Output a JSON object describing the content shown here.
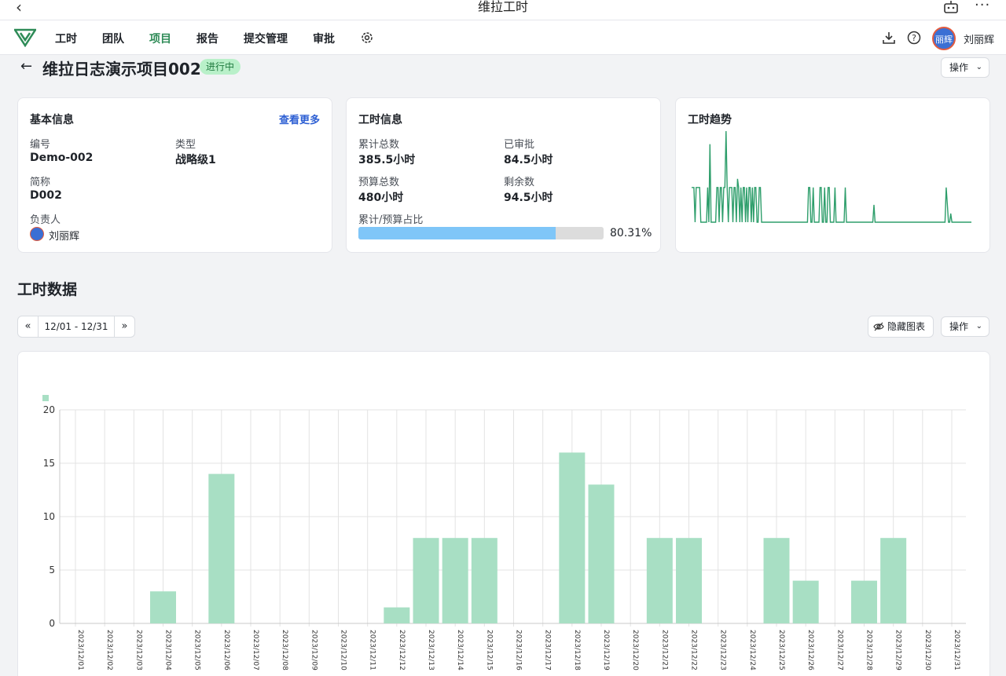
{
  "titlebar": {
    "back": "‹",
    "title": "维拉工时",
    "more": "···"
  },
  "nav": {
    "items": [
      "工时",
      "团队",
      "项目",
      "报告",
      "提交管理",
      "审批"
    ],
    "active": "项目",
    "avatar_text": "丽辉",
    "user": "刘丽辉"
  },
  "page": {
    "back": "←",
    "title": "维拉日志演示项目002",
    "status": "进行中",
    "op_label": "操作"
  },
  "basic": {
    "title": "基本信息",
    "more": "查看更多",
    "code_label": "编号",
    "code": "Demo-002",
    "type_label": "类型",
    "type": "战略级1",
    "short_label": "简称",
    "short": "D002",
    "owner_label": "负责人",
    "owner": "刘丽辉"
  },
  "hours": {
    "title": "工时信息",
    "total_label": "累计总数",
    "total": "385.5小时",
    "approved_label": "已审批",
    "approved": "84.5小时",
    "budget_label": "预算总数",
    "budget": "480小时",
    "remain_label": "剩余数",
    "remain": "94.5小时",
    "ratio_label": "累计/预算占比",
    "ratio": "80.31%",
    "ratio_value": 80.31
  },
  "trend": {
    "title": "工时趋势",
    "color": "#2e9e6b",
    "values": [
      8,
      8,
      8,
      0,
      8,
      8,
      8,
      8,
      0,
      0,
      0,
      0,
      0,
      0,
      8,
      0,
      18,
      0,
      0,
      0,
      0,
      0,
      8,
      8,
      0,
      8,
      8,
      0,
      8,
      8,
      21,
      8,
      0,
      8,
      8,
      8,
      0,
      8,
      8,
      0,
      10,
      8,
      0,
      8,
      0,
      8,
      8,
      0,
      8,
      0,
      8,
      8,
      0,
      8,
      0,
      8,
      8,
      0,
      0,
      8,
      8,
      0,
      0,
      0,
      0,
      0,
      0,
      0,
      0,
      0,
      0,
      0,
      0,
      0,
      0,
      0,
      0,
      0,
      0,
      0,
      0,
      0,
      0,
      0,
      0,
      0,
      0,
      0,
      0,
      0,
      0,
      0,
      0,
      0,
      0,
      0,
      0,
      0,
      0,
      0,
      0,
      0,
      8,
      8,
      0,
      0,
      8,
      0,
      0,
      0,
      0,
      0,
      8,
      8,
      0,
      0,
      8,
      0,
      0,
      8,
      8,
      0,
      0,
      0,
      0,
      8,
      0,
      0,
      0,
      0,
      0,
      0,
      0,
      0,
      8,
      0,
      0,
      0,
      0,
      0,
      0,
      0,
      0,
      0,
      0,
      0,
      0,
      0,
      0,
      0,
      0,
      0,
      0,
      0,
      0,
      0,
      0,
      0,
      0,
      4,
      0,
      0,
      0,
      0,
      0,
      0,
      0,
      0,
      0,
      0,
      0,
      0,
      0,
      0,
      0,
      0,
      0,
      0,
      0,
      0,
      0,
      0,
      0,
      0,
      0,
      0,
      0,
      0,
      0,
      0,
      0,
      0,
      0,
      0,
      0,
      0,
      0,
      0,
      0,
      0,
      0,
      0,
      0,
      0,
      0,
      0,
      0,
      0,
      0,
      0,
      0,
      0,
      0,
      0,
      0,
      0,
      0,
      0,
      0,
      0,
      0,
      0,
      8,
      4,
      0,
      0,
      2,
      0,
      0,
      0,
      0,
      0,
      0,
      0,
      0,
      0,
      0,
      0,
      0,
      0,
      0,
      0,
      0,
      0,
      0
    ]
  },
  "section": {
    "title": "工时数据",
    "range": "12/01 - 12/31",
    "hide_label": "隐藏图表",
    "op_label": "操作"
  },
  "chart_data": {
    "type": "bar",
    "color": "#a8dfc4",
    "ylim": [
      0,
      20
    ],
    "yticks": [
      0,
      5,
      10,
      15,
      20
    ],
    "categories": [
      "2023/12/01",
      "2023/12/02",
      "2023/12/03",
      "2023/12/04",
      "2023/12/05",
      "2023/12/06",
      "2023/12/07",
      "2023/12/08",
      "2023/12/09",
      "2023/12/10",
      "2023/12/11",
      "2023/12/12",
      "2023/12/13",
      "2023/12/14",
      "2023/12/15",
      "2023/12/16",
      "2023/12/17",
      "2023/12/18",
      "2023/12/19",
      "2023/12/20",
      "2023/12/21",
      "2023/12/22",
      "2023/12/23",
      "2023/12/24",
      "2023/12/25",
      "2023/12/26",
      "2023/12/27",
      "2023/12/28",
      "2023/12/29",
      "2023/12/30",
      "2023/12/31"
    ],
    "values": [
      0,
      0,
      0,
      3,
      0,
      14,
      0,
      0,
      0,
      0,
      0,
      1.5,
      8,
      8,
      8,
      0,
      0,
      16,
      13,
      0,
      8,
      8,
      0,
      0,
      8,
      4,
      0,
      4,
      8,
      0,
      0
    ],
    "grid": true
  }
}
